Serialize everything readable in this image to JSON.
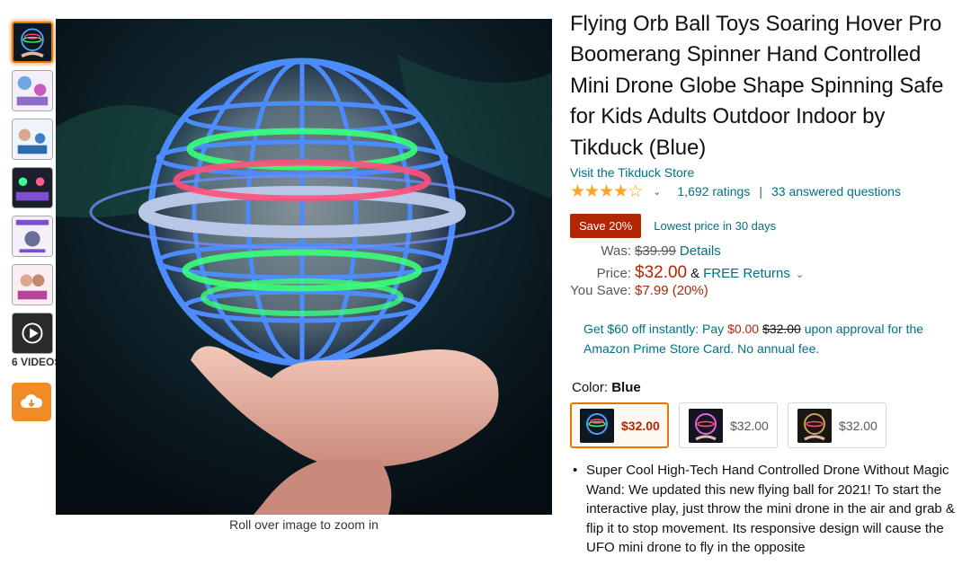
{
  "thumbnails": [
    {
      "name": "thumb-1",
      "active": true
    },
    {
      "name": "thumb-2",
      "active": false
    },
    {
      "name": "thumb-3",
      "active": false
    },
    {
      "name": "thumb-4",
      "active": false
    },
    {
      "name": "thumb-5",
      "active": false
    },
    {
      "name": "thumb-6",
      "active": false
    },
    {
      "name": "thumb-video",
      "active": false
    }
  ],
  "videos_label": "6 VIDEOS",
  "zoom_hint": "Roll over image to zoom in",
  "product": {
    "title": "Flying Orb Ball Toys Soaring Hover Pro Boomerang Spinner Hand Controlled Mini Drone Globe Shape Spinning Safe for Kids Adults Outdoor Indoor by Tikduck (Blue)",
    "store_link": "Visit the Tikduck Store",
    "stars": "★★★★☆",
    "ratings": "1,692 ratings",
    "answered": "33 answered questions"
  },
  "deal": {
    "badge": "Save 20%",
    "lowest": "Lowest price in 30 days"
  },
  "pricing": {
    "was_label": "Was:",
    "was_price": "$39.99",
    "details_link": "Details",
    "price_label": "Price:",
    "price": "$32.00",
    "amp": "&",
    "free_returns": "FREE Returns",
    "save_label": "You Save:",
    "save_value": "$7.99 (20%)"
  },
  "card_offer": {
    "prefix": "Get $60 off instantly: Pay ",
    "new_price": "$0.00",
    "old_price": "$32.00",
    "suffix": " upon approval for the Amazon Prime Store Card. No annual fee."
  },
  "color": {
    "label": "Color:",
    "selected": "Blue"
  },
  "swatches": [
    {
      "price": "$32.00",
      "selected": true
    },
    {
      "price": "$32.00",
      "selected": false
    },
    {
      "price": "$32.00",
      "selected": false
    }
  ],
  "bullets": [
    "Super Cool High-Tech Hand Controlled Drone Without Magic Wand: We updated this new flying ball for 2021! To start the interactive play, just throw the mini drone in the air and grab & flip it to stop movement. Its responsive design will cause the UFO mini drone to fly in the opposite"
  ],
  "colors": {
    "link": "#007185",
    "price_red": "#B12704",
    "star": "#FFA41C",
    "accent_orange": "#e77600",
    "upload_orange": "#f08c25"
  }
}
